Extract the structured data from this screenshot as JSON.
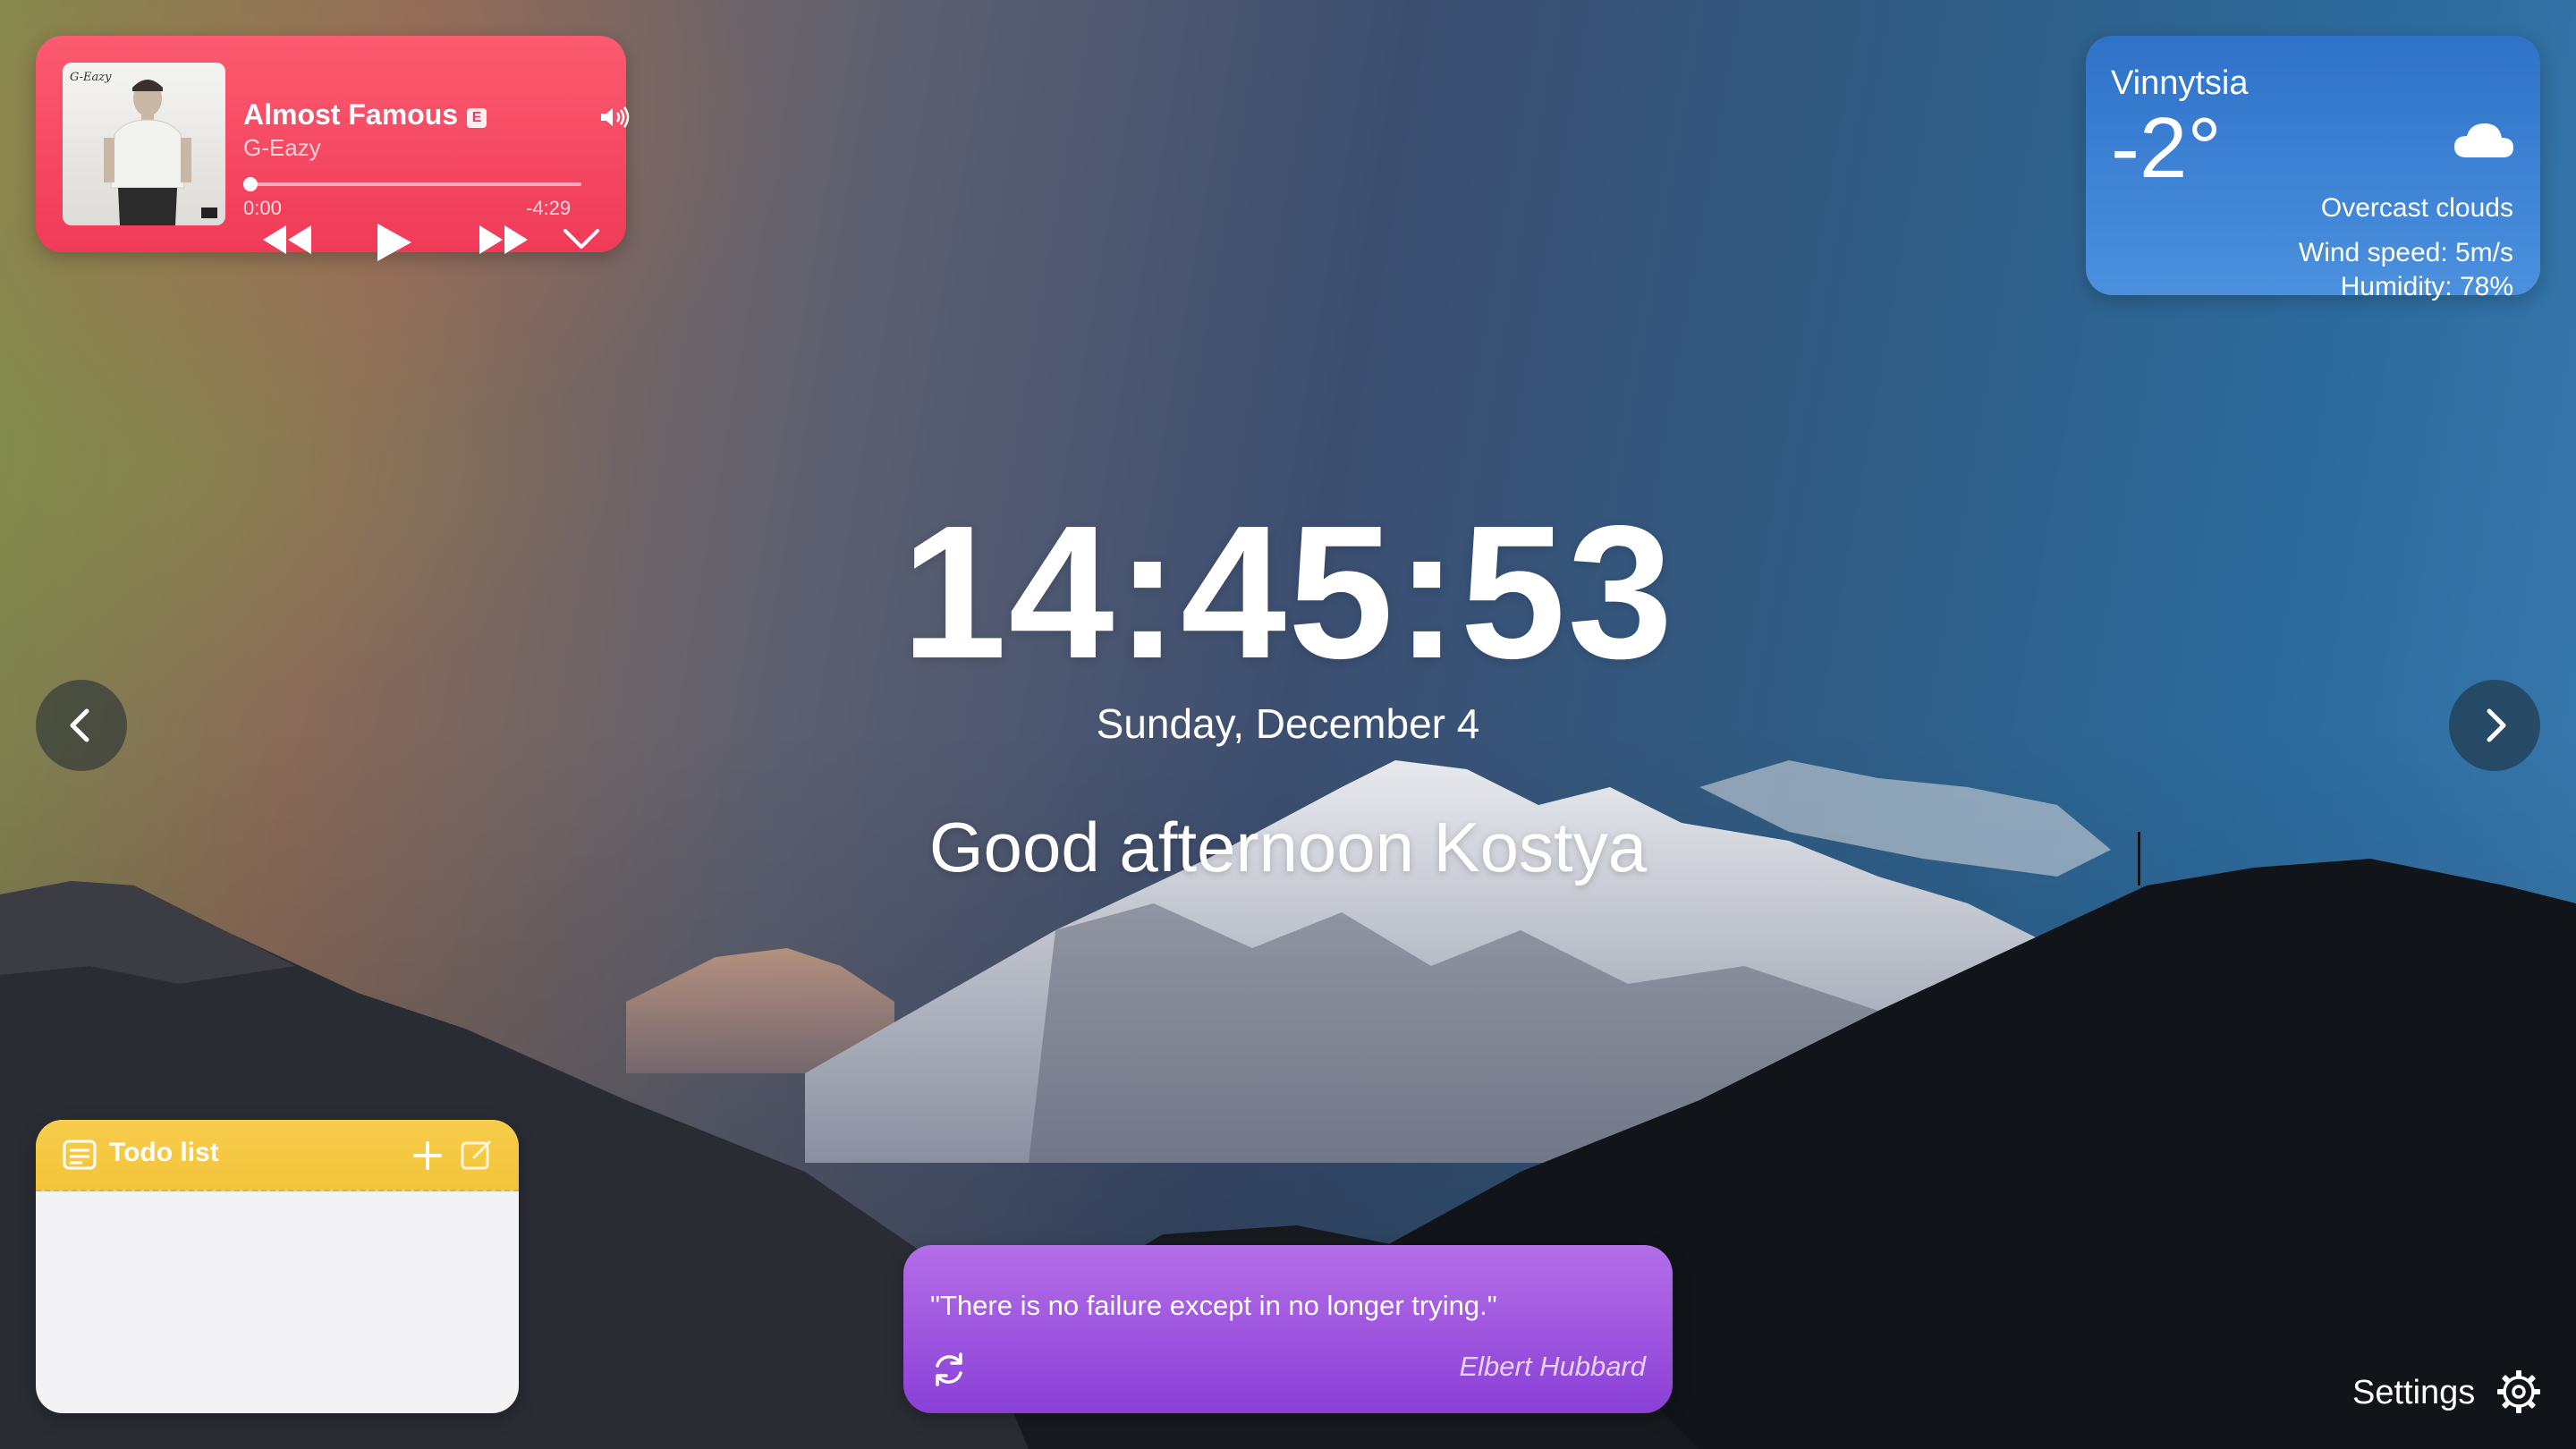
{
  "music": {
    "title": "Almost Famous",
    "explicit_badge": "E",
    "artist": "G-Eazy",
    "current_time": "0:00",
    "remaining_time": "-4:29",
    "progress": 0.0,
    "icons": [
      "album-cover",
      "volume-icon",
      "rewind-icon",
      "play-icon",
      "fast-forward-icon",
      "chevron-down-icon"
    ],
    "accent": "#f03a58"
  },
  "weather": {
    "city": "Vinnytsia",
    "temperature": "-2°",
    "description": "Overcast clouds",
    "wind": "Wind speed: 5m/s",
    "humidity": "Humidity: 78%",
    "icon": "cloud-icon",
    "accent": "#2f72c9"
  },
  "center": {
    "time": "14:45:53",
    "date": "Sunday, December 4",
    "greeting": "Good afternoon Kostya"
  },
  "navigation": {
    "prev_icon": "chevron-left-icon",
    "next_icon": "chevron-right-icon"
  },
  "todo": {
    "title": "Todo list",
    "items": [],
    "icons": [
      "note-icon",
      "add-icon",
      "edit-icon"
    ],
    "accent": "#f3c43a"
  },
  "quote": {
    "text": "\"There is no failure except in no longer trying.\"",
    "author": "Elbert Hubbard",
    "icon": "refresh-icon",
    "accent": "#8a3fd6"
  },
  "settings": {
    "label": "Settings",
    "icon": "gear-icon"
  }
}
